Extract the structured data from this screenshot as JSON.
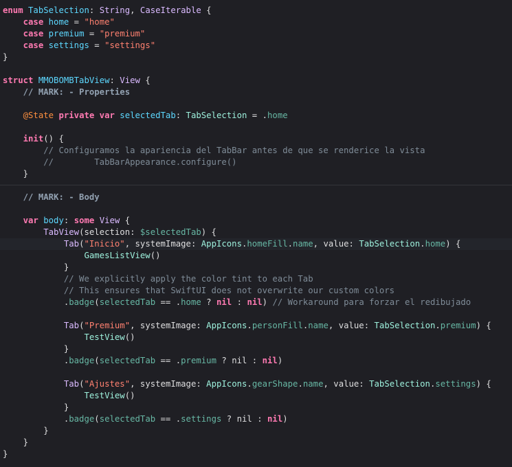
{
  "editor": {
    "language": "Swift",
    "theme_colors": {
      "background": "#1f1f24",
      "current_line": "#23252b",
      "keyword": "#ff7ab2",
      "type": "#dabaff",
      "declared_type": "#5dd8ff",
      "project_type": "#9ef1dd",
      "member": "#67b7a4",
      "string": "#ff8170",
      "comment": "#7f8c98",
      "plain": "#dfdfe0"
    },
    "lines": [
      [
        [
          "keyword",
          "enum "
        ],
        [
          "decltype",
          "TabSelection"
        ],
        [
          "plain",
          ": "
        ],
        [
          "type",
          "String"
        ],
        [
          "plain",
          ", "
        ],
        [
          "type",
          "CaseIterable"
        ],
        [
          "plain",
          " {"
        ]
      ],
      [
        [
          "plain",
          "    "
        ],
        [
          "keyword",
          "case "
        ],
        [
          "decltype",
          "home"
        ],
        [
          "plain",
          " = "
        ],
        [
          "string",
          "\"home\""
        ]
      ],
      [
        [
          "plain",
          "    "
        ],
        [
          "keyword",
          "case "
        ],
        [
          "decltype",
          "premium"
        ],
        [
          "plain",
          " = "
        ],
        [
          "string",
          "\"premium\""
        ]
      ],
      [
        [
          "plain",
          "    "
        ],
        [
          "keyword",
          "case "
        ],
        [
          "decltype",
          "settings"
        ],
        [
          "plain",
          " = "
        ],
        [
          "string",
          "\"settings\""
        ]
      ],
      [
        [
          "plain",
          "}"
        ]
      ],
      [],
      [
        [
          "keyword",
          "struct "
        ],
        [
          "decltype",
          "MMOBOMBTabView"
        ],
        [
          "plain",
          ": "
        ],
        [
          "type",
          "View"
        ],
        [
          "plain",
          " {"
        ]
      ],
      [
        [
          "plain",
          "    "
        ],
        [
          "mark",
          "// MARK: - Properties"
        ]
      ],
      [],
      [
        [
          "plain",
          "    "
        ],
        [
          "attr",
          "@State "
        ],
        [
          "keyword",
          "private var "
        ],
        [
          "decltype",
          "selectedTab"
        ],
        [
          "plain",
          ": "
        ],
        [
          "projtype",
          "TabSelection"
        ],
        [
          "plain",
          " = ."
        ],
        [
          "member",
          "home"
        ]
      ],
      [],
      [
        [
          "plain",
          "    "
        ],
        [
          "keyword",
          "init"
        ],
        [
          "plain",
          "() {"
        ]
      ],
      [
        [
          "plain",
          "        "
        ],
        [
          "comment",
          "// Configuramos la apariencia del TabBar antes de que se renderice la vista"
        ]
      ],
      [
        [
          "plain",
          "        "
        ],
        [
          "comment",
          "//        TabBarAppearance.configure()"
        ]
      ],
      [
        [
          "plain",
          "    }"
        ]
      ],
      [],
      [
        [
          "plain",
          "    "
        ],
        [
          "mark",
          "// MARK: - Body"
        ]
      ],
      [],
      [
        [
          "plain",
          "    "
        ],
        [
          "keyword",
          "var "
        ],
        [
          "decltype",
          "body"
        ],
        [
          "plain",
          ": "
        ],
        [
          "keyword",
          "some "
        ],
        [
          "type",
          "View"
        ],
        [
          "plain",
          " {"
        ]
      ],
      [
        [
          "plain",
          "        "
        ],
        [
          "type",
          "TabView"
        ],
        [
          "plain",
          "(selection: "
        ],
        [
          "member",
          "$selectedTab"
        ],
        [
          "plain",
          ") {"
        ]
      ],
      [
        [
          "plain",
          "            "
        ],
        [
          "type",
          "Tab"
        ],
        [
          "plain",
          "("
        ],
        [
          "string",
          "\"Inicio\""
        ],
        [
          "plain",
          ", systemImage: "
        ],
        [
          "projtype",
          "AppIcons"
        ],
        [
          "plain",
          "."
        ],
        [
          "member",
          "homeFill"
        ],
        [
          "plain",
          "."
        ],
        [
          "member",
          "name"
        ],
        [
          "plain",
          ", value: "
        ],
        [
          "projtype",
          "TabSelection"
        ],
        [
          "plain",
          "."
        ],
        [
          "member",
          "home"
        ],
        [
          "plain",
          ") {"
        ]
      ],
      [
        [
          "plain",
          "                "
        ],
        [
          "projtype",
          "GamesListView"
        ],
        [
          "plain",
          "()"
        ]
      ],
      [
        [
          "plain",
          "            }"
        ]
      ],
      [
        [
          "plain",
          "            "
        ],
        [
          "comment",
          "// We explicitly apply the color tint to each Tab"
        ]
      ],
      [
        [
          "plain",
          "            "
        ],
        [
          "comment",
          "// This ensures that SwiftUI does not overwrite our custom colors"
        ]
      ],
      [
        [
          "plain",
          "            ."
        ],
        [
          "member",
          "badge"
        ],
        [
          "plain",
          "("
        ],
        [
          "member",
          "selectedTab"
        ],
        [
          "plain",
          " == ."
        ],
        [
          "member",
          "home"
        ],
        [
          "plain",
          " ? "
        ],
        [
          "keyword",
          "nil"
        ],
        [
          "plain",
          " : "
        ],
        [
          "keyword",
          "nil"
        ],
        [
          "plain",
          ") "
        ],
        [
          "comment",
          "// Workaround para forzar el redibujado"
        ]
      ],
      [],
      [
        [
          "plain",
          "            "
        ],
        [
          "type",
          "Tab"
        ],
        [
          "plain",
          "("
        ],
        [
          "string",
          "\"Premium\""
        ],
        [
          "plain",
          ", systemImage: "
        ],
        [
          "projtype",
          "AppIcons"
        ],
        [
          "plain",
          "."
        ],
        [
          "member",
          "personFill"
        ],
        [
          "plain",
          "."
        ],
        [
          "member",
          "name"
        ],
        [
          "plain",
          ", value: "
        ],
        [
          "projtype",
          "TabSelection"
        ],
        [
          "plain",
          "."
        ],
        [
          "member",
          "premium"
        ],
        [
          "plain",
          ") {"
        ]
      ],
      [
        [
          "plain",
          "                "
        ],
        [
          "projtype",
          "TestView"
        ],
        [
          "plain",
          "()"
        ]
      ],
      [
        [
          "plain",
          "            }"
        ]
      ],
      [
        [
          "plain",
          "            ."
        ],
        [
          "member",
          "badge"
        ],
        [
          "plain",
          "("
        ],
        [
          "member",
          "selectedTab"
        ],
        [
          "plain",
          " == ."
        ],
        [
          "member",
          "premium"
        ],
        [
          "plain",
          " ? nil : "
        ],
        [
          "keyword",
          "nil"
        ],
        [
          "plain",
          ")"
        ]
      ],
      [],
      [
        [
          "plain",
          "            "
        ],
        [
          "type",
          "Tab"
        ],
        [
          "plain",
          "("
        ],
        [
          "string",
          "\"Ajustes\""
        ],
        [
          "plain",
          ", systemImage: "
        ],
        [
          "projtype",
          "AppIcons"
        ],
        [
          "plain",
          "."
        ],
        [
          "member",
          "gearShape"
        ],
        [
          "plain",
          "."
        ],
        [
          "member",
          "name"
        ],
        [
          "plain",
          ", value: "
        ],
        [
          "projtype",
          "TabSelection"
        ],
        [
          "plain",
          "."
        ],
        [
          "member",
          "settings"
        ],
        [
          "plain",
          ") {"
        ]
      ],
      [
        [
          "plain",
          "                "
        ],
        [
          "projtype",
          "TestView"
        ],
        [
          "plain",
          "()"
        ]
      ],
      [
        [
          "plain",
          "            }"
        ]
      ],
      [
        [
          "plain",
          "            ."
        ],
        [
          "member",
          "badge"
        ],
        [
          "plain",
          "("
        ],
        [
          "member",
          "selectedTab"
        ],
        [
          "plain",
          " == ."
        ],
        [
          "member",
          "settings"
        ],
        [
          "plain",
          " ? nil : "
        ],
        [
          "keyword",
          "nil"
        ],
        [
          "plain",
          ")"
        ]
      ],
      [
        [
          "plain",
          "        }"
        ]
      ],
      [
        [
          "plain",
          "    }"
        ]
      ],
      [
        [
          "plain",
          "}"
        ]
      ]
    ]
  }
}
